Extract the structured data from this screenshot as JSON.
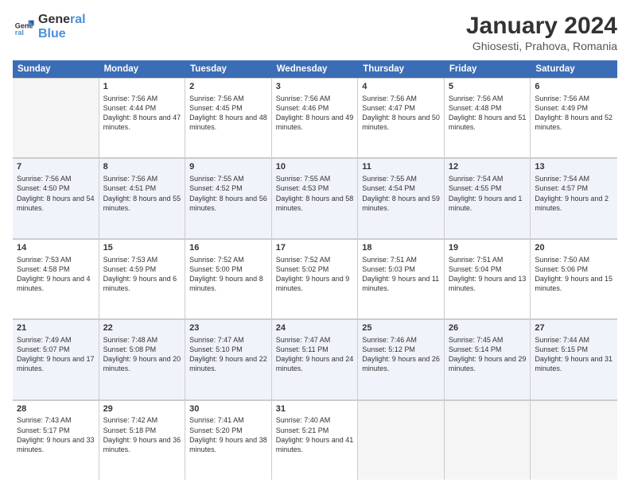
{
  "logo": {
    "general": "General",
    "blue": "Blue"
  },
  "header": {
    "title": "January 2024",
    "subtitle": "Ghiosesti, Prahova, Romania"
  },
  "weekdays": [
    "Sunday",
    "Monday",
    "Tuesday",
    "Wednesday",
    "Thursday",
    "Friday",
    "Saturday"
  ],
  "weeks": [
    [
      {
        "day": "",
        "empty": true
      },
      {
        "day": "1",
        "sunrise": "7:56 AM",
        "sunset": "4:44 PM",
        "daylight": "8 hours and 47 minutes."
      },
      {
        "day": "2",
        "sunrise": "7:56 AM",
        "sunset": "4:45 PM",
        "daylight": "8 hours and 48 minutes."
      },
      {
        "day": "3",
        "sunrise": "7:56 AM",
        "sunset": "4:46 PM",
        "daylight": "8 hours and 49 minutes."
      },
      {
        "day": "4",
        "sunrise": "7:56 AM",
        "sunset": "4:47 PM",
        "daylight": "8 hours and 50 minutes."
      },
      {
        "day": "5",
        "sunrise": "7:56 AM",
        "sunset": "4:48 PM",
        "daylight": "8 hours and 51 minutes."
      },
      {
        "day": "6",
        "sunrise": "7:56 AM",
        "sunset": "4:49 PM",
        "daylight": "8 hours and 52 minutes."
      }
    ],
    [
      {
        "day": "7",
        "sunrise": "7:56 AM",
        "sunset": "4:50 PM",
        "daylight": "8 hours and 54 minutes."
      },
      {
        "day": "8",
        "sunrise": "7:56 AM",
        "sunset": "4:51 PM",
        "daylight": "8 hours and 55 minutes."
      },
      {
        "day": "9",
        "sunrise": "7:55 AM",
        "sunset": "4:52 PM",
        "daylight": "8 hours and 56 minutes."
      },
      {
        "day": "10",
        "sunrise": "7:55 AM",
        "sunset": "4:53 PM",
        "daylight": "8 hours and 58 minutes."
      },
      {
        "day": "11",
        "sunrise": "7:55 AM",
        "sunset": "4:54 PM",
        "daylight": "8 hours and 59 minutes."
      },
      {
        "day": "12",
        "sunrise": "7:54 AM",
        "sunset": "4:55 PM",
        "daylight": "9 hours and 1 minute."
      },
      {
        "day": "13",
        "sunrise": "7:54 AM",
        "sunset": "4:57 PM",
        "daylight": "9 hours and 2 minutes."
      }
    ],
    [
      {
        "day": "14",
        "sunrise": "7:53 AM",
        "sunset": "4:58 PM",
        "daylight": "9 hours and 4 minutes."
      },
      {
        "day": "15",
        "sunrise": "7:53 AM",
        "sunset": "4:59 PM",
        "daylight": "9 hours and 6 minutes."
      },
      {
        "day": "16",
        "sunrise": "7:52 AM",
        "sunset": "5:00 PM",
        "daylight": "9 hours and 8 minutes."
      },
      {
        "day": "17",
        "sunrise": "7:52 AM",
        "sunset": "5:02 PM",
        "daylight": "9 hours and 9 minutes."
      },
      {
        "day": "18",
        "sunrise": "7:51 AM",
        "sunset": "5:03 PM",
        "daylight": "9 hours and 11 minutes."
      },
      {
        "day": "19",
        "sunrise": "7:51 AM",
        "sunset": "5:04 PM",
        "daylight": "9 hours and 13 minutes."
      },
      {
        "day": "20",
        "sunrise": "7:50 AM",
        "sunset": "5:06 PM",
        "daylight": "9 hours and 15 minutes."
      }
    ],
    [
      {
        "day": "21",
        "sunrise": "7:49 AM",
        "sunset": "5:07 PM",
        "daylight": "9 hours and 17 minutes."
      },
      {
        "day": "22",
        "sunrise": "7:48 AM",
        "sunset": "5:08 PM",
        "daylight": "9 hours and 20 minutes."
      },
      {
        "day": "23",
        "sunrise": "7:47 AM",
        "sunset": "5:10 PM",
        "daylight": "9 hours and 22 minutes."
      },
      {
        "day": "24",
        "sunrise": "7:47 AM",
        "sunset": "5:11 PM",
        "daylight": "9 hours and 24 minutes."
      },
      {
        "day": "25",
        "sunrise": "7:46 AM",
        "sunset": "5:12 PM",
        "daylight": "9 hours and 26 minutes."
      },
      {
        "day": "26",
        "sunrise": "7:45 AM",
        "sunset": "5:14 PM",
        "daylight": "9 hours and 29 minutes."
      },
      {
        "day": "27",
        "sunrise": "7:44 AM",
        "sunset": "5:15 PM",
        "daylight": "9 hours and 31 minutes."
      }
    ],
    [
      {
        "day": "28",
        "sunrise": "7:43 AM",
        "sunset": "5:17 PM",
        "daylight": "9 hours and 33 minutes."
      },
      {
        "day": "29",
        "sunrise": "7:42 AM",
        "sunset": "5:18 PM",
        "daylight": "9 hours and 36 minutes."
      },
      {
        "day": "30",
        "sunrise": "7:41 AM",
        "sunset": "5:20 PM",
        "daylight": "9 hours and 38 minutes."
      },
      {
        "day": "31",
        "sunrise": "7:40 AM",
        "sunset": "5:21 PM",
        "daylight": "9 hours and 41 minutes."
      },
      {
        "day": "",
        "empty": true
      },
      {
        "day": "",
        "empty": true
      },
      {
        "day": "",
        "empty": true
      }
    ]
  ]
}
